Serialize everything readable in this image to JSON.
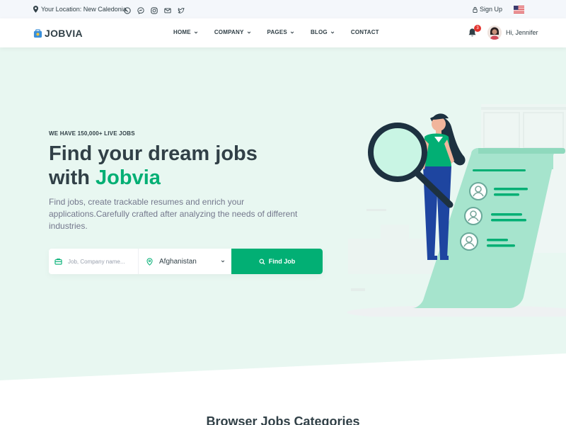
{
  "topbar": {
    "location_label": "Your Location:",
    "location_value": "New Caledonia",
    "social_icons": [
      "whatsapp-icon",
      "messenger-icon",
      "instagram-icon",
      "envelope-icon",
      "twitter-icon"
    ],
    "signup_label": "Sign Up"
  },
  "header": {
    "logo_text": "JOBVIA",
    "nav": [
      {
        "label": "HOME",
        "dropdown": true
      },
      {
        "label": "COMPANY",
        "dropdown": true
      },
      {
        "label": "PAGES",
        "dropdown": true
      },
      {
        "label": "BLOG",
        "dropdown": true
      },
      {
        "label": "CONTACT",
        "dropdown": false
      }
    ],
    "notification_count": "3",
    "greeting": "Hi, Jennifer"
  },
  "hero": {
    "kicker": "WE HAVE 150,000+ LIVE JOBS",
    "headline_line1": "Find your dream jobs",
    "headline_line2_prefix": "with ",
    "headline_accent": "Jobvia",
    "description": "Find jobs, create trackable resumes and enrich your applications.Carefully crafted after analyzing the needs of different industries.",
    "search": {
      "keyword_placeholder": "Job, Company name...",
      "location_value": "Afghanistan",
      "button_label": "Find Job"
    }
  },
  "section": {
    "title": "Browser Jobs Categories"
  },
  "colors": {
    "brand": "#02af74",
    "hero_bg": "#e8f7f1",
    "text": "#314047",
    "muted": "#74788d"
  }
}
